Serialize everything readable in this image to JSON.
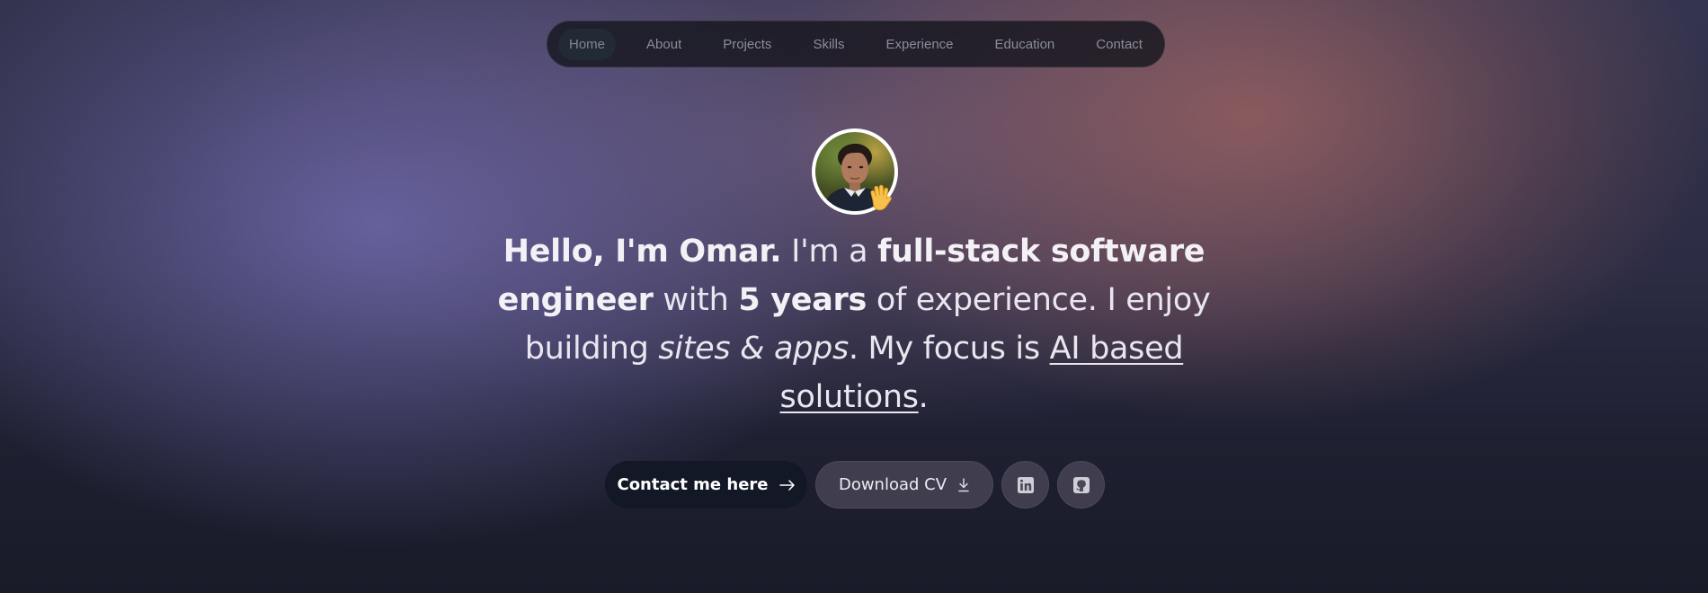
{
  "nav": {
    "items": [
      {
        "label": "Home",
        "active": true
      },
      {
        "label": "About"
      },
      {
        "label": "Projects"
      },
      {
        "label": "Skills"
      },
      {
        "label": "Experience"
      },
      {
        "label": "Education"
      },
      {
        "label": "Contact"
      }
    ]
  },
  "hero": {
    "avatar_icon": "profile-photo",
    "wave_icon": "waving-hand-icon",
    "headline": {
      "greeting": "Hello, I'm Omar.",
      "text1": " I'm a ",
      "role": "full-stack software engineer",
      "text2": " with ",
      "years": "5 years",
      "text3": " of experience. I enjoy building ",
      "building": "sites & apps",
      "text4": ". My focus is ",
      "focus": "AI based solutions",
      "text5": "."
    }
  },
  "actions": {
    "contact_label": "Contact me here",
    "contact_icon": "arrow-right-icon",
    "cv_label": "Download CV",
    "cv_icon": "download-icon",
    "linkedin_icon": "linkedin-icon",
    "github_icon": "github-icon"
  }
}
